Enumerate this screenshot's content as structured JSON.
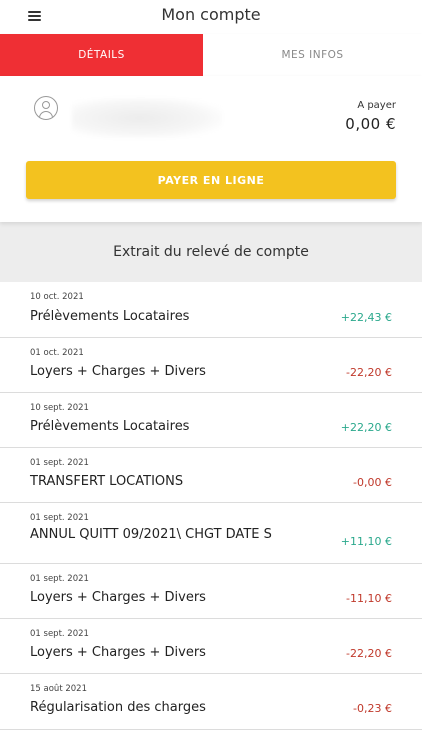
{
  "header": {
    "title": "Mon compte",
    "menu_icon": "hamburger-menu-icon"
  },
  "tabs": [
    {
      "label": "DÉTAILS",
      "active": true
    },
    {
      "label": "MES INFOS",
      "active": false
    }
  ],
  "account": {
    "avatar_icon": "user-avatar-icon",
    "due_label": "A payer",
    "due_amount": "0,00 €",
    "pay_button_label": "PAYER EN LIGNE"
  },
  "statement": {
    "title": "Extrait du relevé de compte",
    "transactions": [
      {
        "date": "10 oct. 2021",
        "label": "Prélèvements Locataires",
        "amount": "+22,43 €",
        "type": "credit"
      },
      {
        "date": "01 oct. 2021",
        "label": "Loyers + Charges + Divers",
        "amount": "-22,20 €",
        "type": "debit"
      },
      {
        "date": "10 sept. 2021",
        "label": "Prélèvements Locataires",
        "amount": "+22,20 €",
        "type": "credit"
      },
      {
        "date": "01 sept. 2021",
        "label": "TRANSFERT LOCATIONS",
        "amount": "-0,00 €",
        "type": "debit"
      },
      {
        "date": "01 sept. 2021",
        "label": "ANNUL QUITT 09/2021\\ CHGT DATE S",
        "amount": "+11,10 €",
        "type": "credit"
      },
      {
        "date": "01 sept. 2021",
        "label": "Loyers + Charges + Divers",
        "amount": "-11,10 €",
        "type": "debit"
      },
      {
        "date": "01 sept. 2021",
        "label": "Loyers + Charges + Divers",
        "amount": "-22,20 €",
        "type": "debit"
      },
      {
        "date": "15 août 2021",
        "label": "Régularisation des charges",
        "amount": "-0,23 €",
        "type": "debit"
      }
    ]
  },
  "colors": {
    "accent_red": "#ef2f34",
    "pay_yellow": "#f3c21f",
    "credit_green": "#2aa88c",
    "debit_red": "#c0392b",
    "section_gray": "#ededed"
  }
}
